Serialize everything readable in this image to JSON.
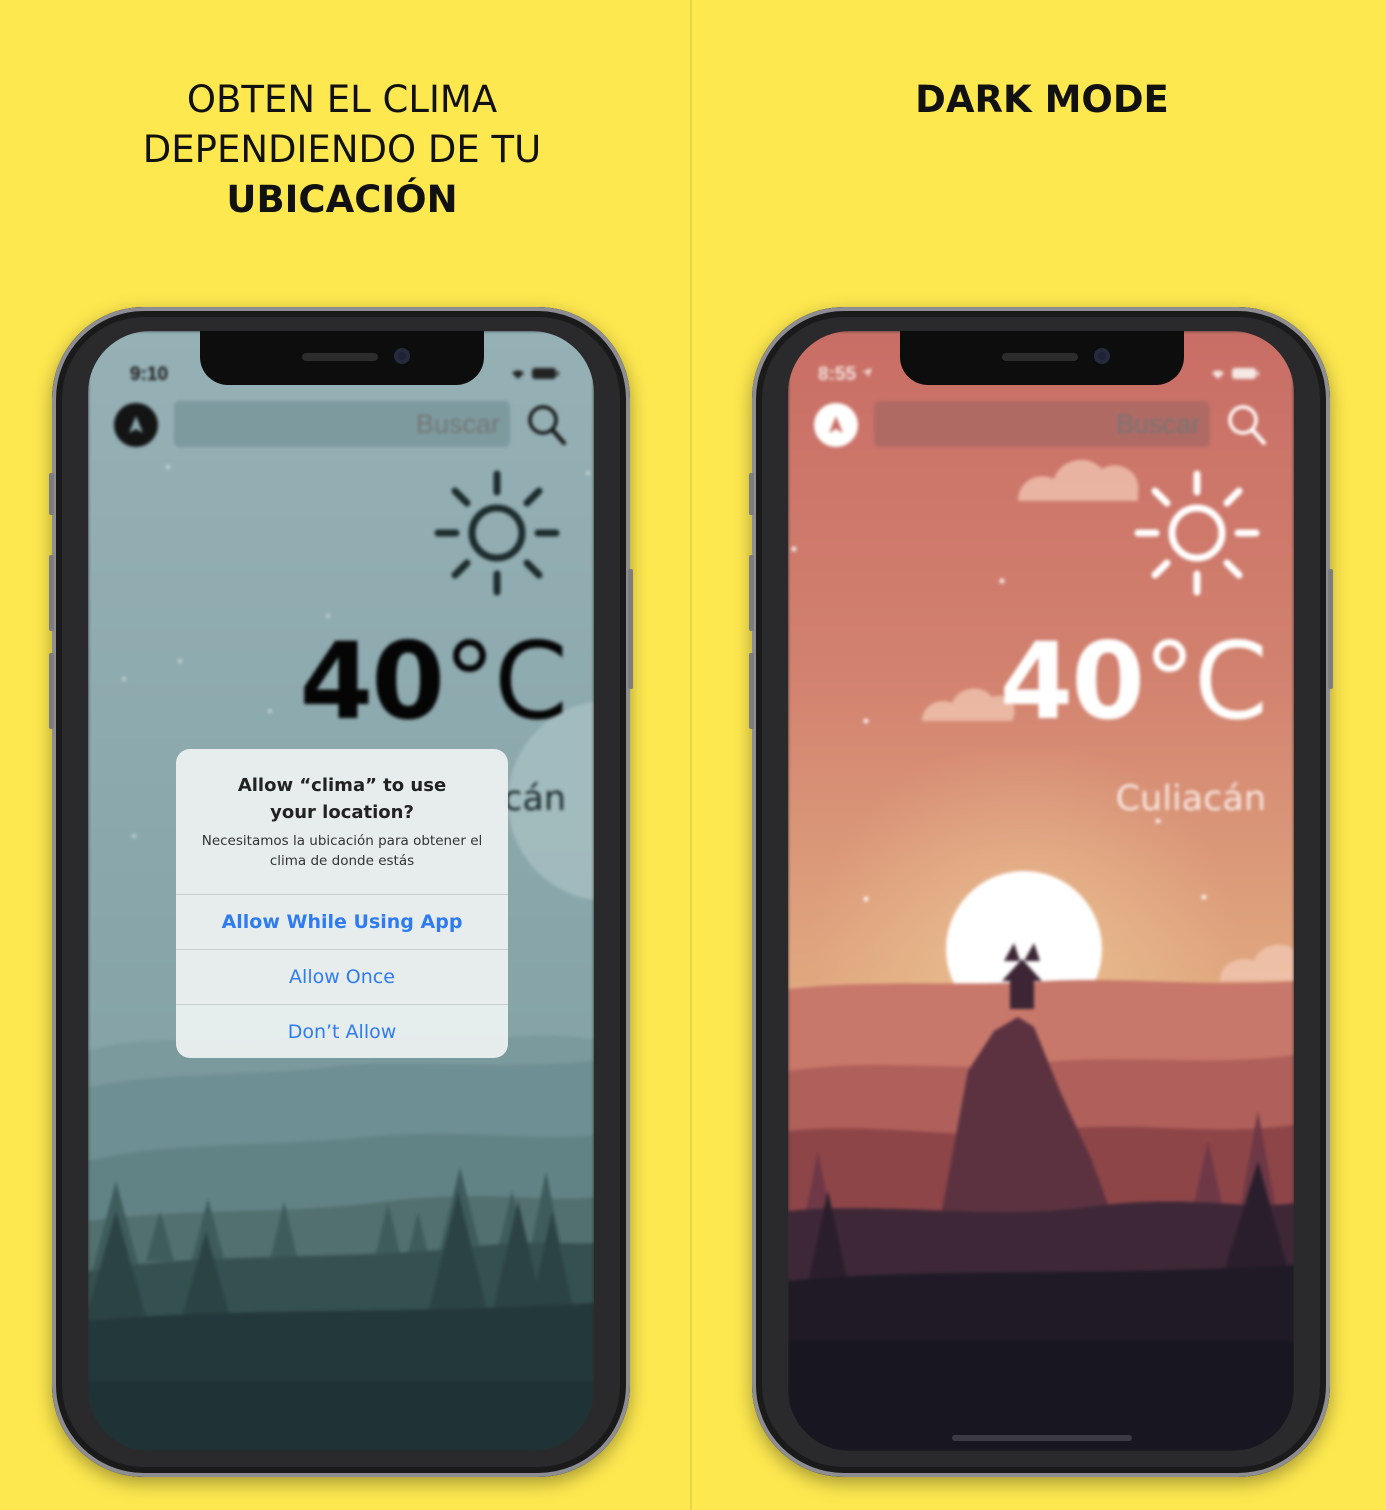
{
  "left_panel": {
    "headline_line1": "OBTEN EL CLIMA",
    "headline_line2": "DEPENDIENDO DE TU",
    "headline_bold": "UBICACIÓN",
    "phone": {
      "status_time": "9:10",
      "search_placeholder": "Buscar",
      "temp_value": "40",
      "temp_unit": "°C",
      "city_partial": "cán",
      "alert": {
        "title_line1": "Allow “clima” to use",
        "title_line2": "your location?",
        "message": "Necesitamos la ubicación para obtener el clima de donde estás",
        "buttons": [
          "Allow While Using App",
          "Allow Once",
          "Don’t Allow"
        ]
      }
    }
  },
  "right_panel": {
    "headline": "DARK MODE",
    "phone": {
      "status_time": "8:55",
      "search_placeholder": "Buscar",
      "temp_value": "40",
      "temp_unit": "°C",
      "city": "Culiacán"
    }
  },
  "icons": {
    "navigation": "navigation-arrow-icon",
    "search": "search-icon",
    "weather": "sun-icon",
    "wifi": "wifi-icon",
    "battery": "battery-icon",
    "location": "location-arrow-icon"
  },
  "colors": {
    "background": "#FDE84F",
    "alert_button": "#2F7BF0",
    "left_sky": "#8AA8AC",
    "right_sky": "#C97068"
  }
}
